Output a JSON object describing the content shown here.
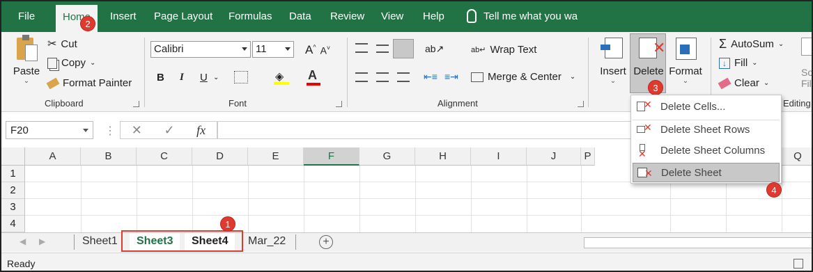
{
  "tabs": [
    {
      "label": "File"
    },
    {
      "label": "Home"
    },
    {
      "label": "Insert"
    },
    {
      "label": "Page Layout"
    },
    {
      "label": "Formulas"
    },
    {
      "label": "Data"
    },
    {
      "label": "Review"
    },
    {
      "label": "View"
    },
    {
      "label": "Help"
    }
  ],
  "tell_me": "Tell me what you wa",
  "clipboard": {
    "paste": "Paste",
    "cut": "Cut",
    "copy": "Copy",
    "format_painter": "Format Painter",
    "label": "Clipboard"
  },
  "font": {
    "name": "Calibri",
    "size": "11",
    "label": "Font",
    "bold": "B",
    "italic": "I",
    "underline": "U"
  },
  "alignment": {
    "wrap_text": "Wrap Text",
    "merge_center": "Merge & Center",
    "label": "Alignment"
  },
  "cells": {
    "insert": "Insert",
    "delete": "Delete",
    "format": "Format"
  },
  "editing": {
    "autosum": "AutoSum",
    "fill": "Fill",
    "clear": "Clear",
    "label": "Editing",
    "sort_partial": "So\nFil"
  },
  "namebox": "F20",
  "formula_icons": {
    "cancel": "✕",
    "enter": "✓",
    "fx": "fx"
  },
  "columns": [
    "A",
    "B",
    "C",
    "D",
    "E",
    "F",
    "G",
    "H",
    "I",
    "J",
    "P",
    "Q"
  ],
  "rows": [
    "1",
    "2",
    "3",
    "4"
  ],
  "sheets": [
    "Sheet1",
    "Sheet3",
    "Sheet4",
    "Mar_22"
  ],
  "status": "Ready",
  "dropdown": [
    {
      "label": "Delete Cells..."
    },
    {
      "label": "Delete Sheet Rows"
    },
    {
      "label": "Delete Sheet Columns"
    },
    {
      "label": "Delete Sheet"
    }
  ],
  "markers": [
    "1",
    "2",
    "3",
    "4"
  ],
  "colors": {
    "excel_green": "#217346",
    "marker_red": "#e03a2f"
  }
}
